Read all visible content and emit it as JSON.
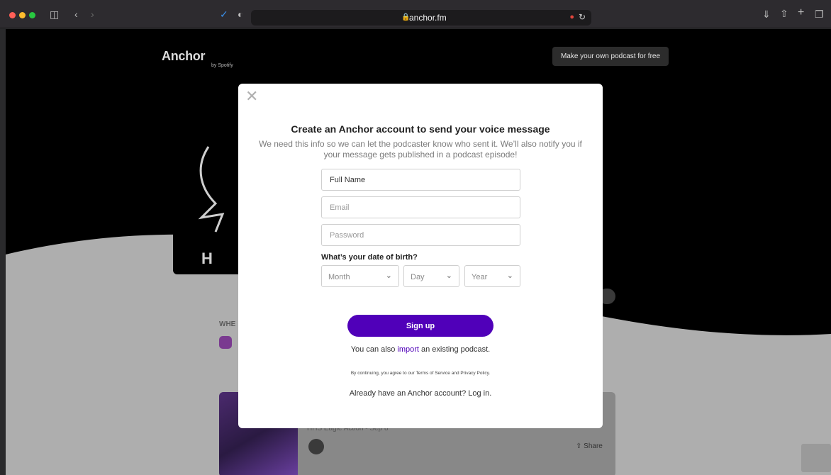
{
  "browser": {
    "url": "anchor.fm",
    "colors": {
      "close": "#ff5f57",
      "minimize": "#febc2e",
      "zoom": "#28c840"
    },
    "icons": [
      "sidebar-icon",
      "back-icon",
      "forward-icon",
      "shield-icon",
      "lock-icon",
      "mic-icon",
      "reload-icon",
      "download-icon",
      "share-icon",
      "new-tab-icon",
      "tabs-icon"
    ]
  },
  "page": {
    "brand": {
      "name": "Anchor",
      "by": "by Spotify"
    },
    "cta_label": "Make your own podcast for free",
    "where_label": "WHE",
    "cover_text": "H",
    "episode_title": "HHS Eagle Action - Sep 8",
    "share_label": "Share"
  },
  "modal": {
    "title": "Create an Anchor account to send your voice message",
    "subtitle": "We need this info so we can let the podcaster know who sent it. We’ll also notify you if your message gets published in a podcast episode!",
    "fields": {
      "full_name": "Full Name",
      "email": "Email",
      "password": "Password"
    },
    "dob_label": "What’s your date of birth?",
    "dob": {
      "month": "Month",
      "day": "Day",
      "year": "Year"
    },
    "signup_label": "Sign up",
    "import_prefix": "You can also ",
    "import_link": "import",
    "import_suffix": " an existing podcast.",
    "terms_prefix": "By continuing, you agree to our ",
    "terms_link": "Terms of Service",
    "terms_and": " and ",
    "privacy_link": "Privacy Policy",
    "terms_suffix": ".",
    "login_text": "Already have an Anchor account? Log in.",
    "accent": "#5000b9"
  }
}
